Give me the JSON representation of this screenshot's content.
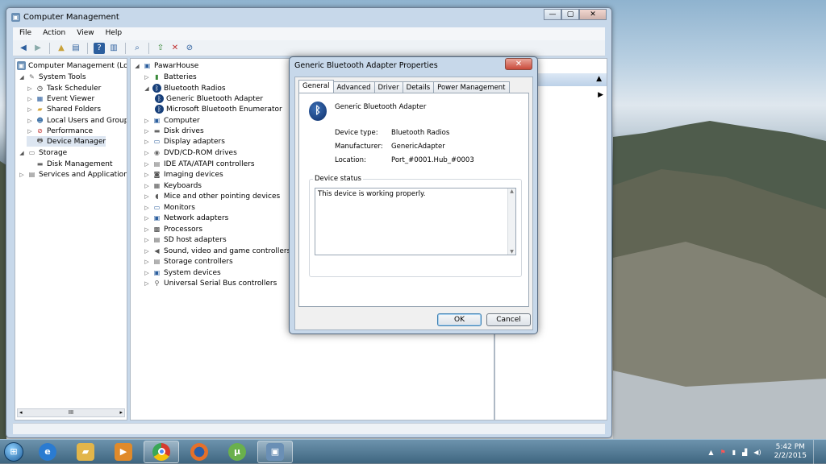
{
  "window": {
    "title": "Computer Management",
    "menu": [
      "File",
      "Action",
      "View",
      "Help"
    ]
  },
  "left_tree": {
    "root": "Computer Management (Local",
    "items": [
      {
        "label": "System Tools"
      },
      {
        "label": "Task Scheduler"
      },
      {
        "label": "Event Viewer"
      },
      {
        "label": "Shared Folders"
      },
      {
        "label": "Local Users and Groups"
      },
      {
        "label": "Performance"
      },
      {
        "label": "Device Manager"
      },
      {
        "label": "Storage"
      },
      {
        "label": "Disk Management"
      },
      {
        "label": "Services and Applications"
      }
    ],
    "scroll_label": "III"
  },
  "device_tree": {
    "root": "PawarHouse",
    "items": [
      {
        "label": "Batteries"
      },
      {
        "label": "Bluetooth Radios"
      },
      {
        "label": "Generic Bluetooth Adapter"
      },
      {
        "label": "Microsoft Bluetooth Enumerator"
      },
      {
        "label": "Computer"
      },
      {
        "label": "Disk drives"
      },
      {
        "label": "Display adapters"
      },
      {
        "label": "DVD/CD-ROM drives"
      },
      {
        "label": "IDE ATA/ATAPI controllers"
      },
      {
        "label": "Imaging devices"
      },
      {
        "label": "Keyboards"
      },
      {
        "label": "Mice and other pointing devices"
      },
      {
        "label": "Monitors"
      },
      {
        "label": "Network adapters"
      },
      {
        "label": "Processors"
      },
      {
        "label": "SD host adapters"
      },
      {
        "label": "Sound, video and game controllers"
      },
      {
        "label": "Storage controllers"
      },
      {
        "label": "System devices"
      },
      {
        "label": "Universal Serial Bus controllers"
      }
    ]
  },
  "actions_pane": {
    "header": "ager",
    "item": "tions"
  },
  "dialog": {
    "title": "Generic Bluetooth Adapter Properties",
    "tabs": [
      "General",
      "Advanced",
      "Driver",
      "Details",
      "Power Management"
    ],
    "device_name": "Generic Bluetooth Adapter",
    "device_type_label": "Device type:",
    "device_type": "Bluetooth Radios",
    "manufacturer_label": "Manufacturer:",
    "manufacturer": "GenericAdapter",
    "location_label": "Location:",
    "location": "Port_#0001.Hub_#0003",
    "status_legend": "Device status",
    "status_text": "This device is working properly.",
    "ok": "OK",
    "cancel": "Cancel"
  },
  "taskbar": {
    "time": "5:42 PM",
    "date": "2/2/2015"
  },
  "colors": {
    "accent": "#3c7fb1",
    "taskbar": "#3f6680"
  }
}
